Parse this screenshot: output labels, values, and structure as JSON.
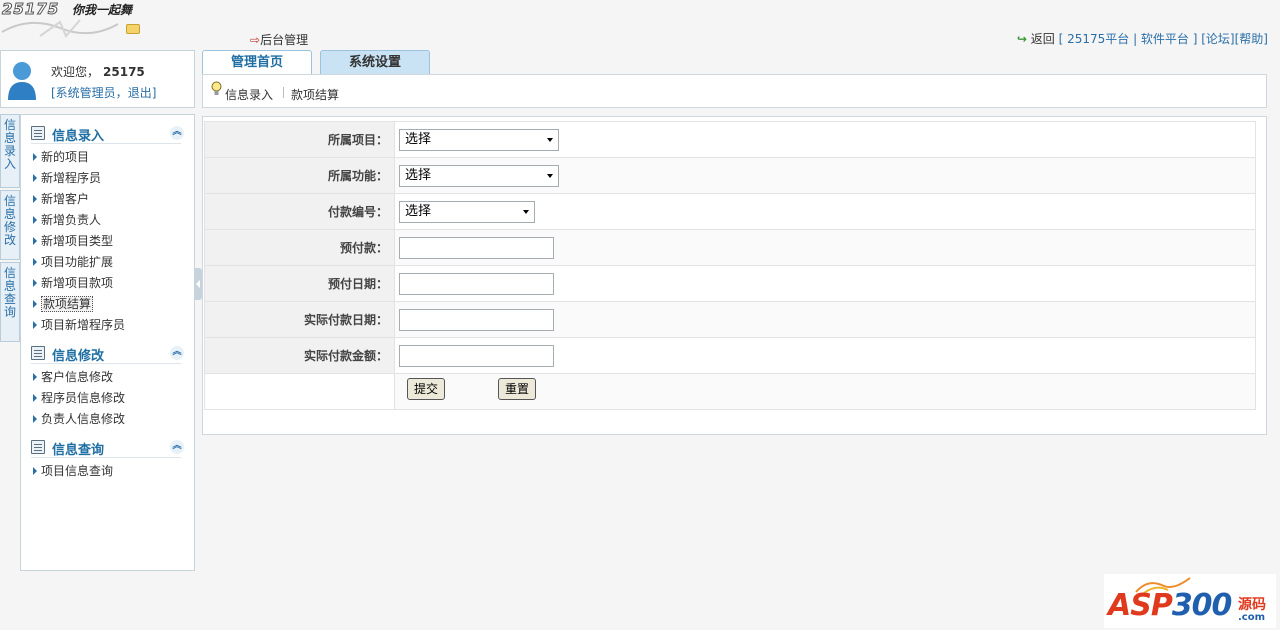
{
  "logo": {
    "number": "25175",
    "slogan": "你我一起舞"
  },
  "header": {
    "admin_link": "后台管理",
    "return_label": "返回",
    "platform_link": "[ 25175平台",
    "separator": " | ",
    "software_link": "软件平台 ]",
    "forum_link": "[论坛]",
    "help_link": "[帮助]"
  },
  "user": {
    "welcome": "欢迎您，",
    "name": "25175",
    "role": "[系统管理员，",
    "logout": "退出]"
  },
  "tabs": [
    {
      "label": "管理首页",
      "active": true
    },
    {
      "label": "系统设置",
      "active": false
    }
  ],
  "subnav": {
    "item1": "信息录入",
    "item2": "款项结算"
  },
  "vtabs": [
    {
      "label": "信息录入"
    },
    {
      "label": "信息修改"
    },
    {
      "label": "信息查询"
    }
  ],
  "menu": {
    "sections": [
      {
        "title": "信息录入",
        "items": [
          "新的项目",
          "新增程序员",
          "新增客户",
          "新增负责人",
          "新增项目类型",
          "项目功能扩展",
          "新增项目款项",
          "款项结算",
          "项目新增程序员"
        ]
      },
      {
        "title": "信息修改",
        "items": [
          "客户信息修改",
          "程序员信息修改",
          "负责人信息修改"
        ]
      },
      {
        "title": "信息查询",
        "items": [
          "项目信息查询"
        ]
      }
    ],
    "collapse_glyph": "︽"
  },
  "form": {
    "project_label": "所属项目：",
    "project_value": "选择",
    "function_label": "所属功能：",
    "function_value": "选择",
    "payment_no_label": "付款编号：",
    "payment_no_value": "选择",
    "prepay_label": "预付款：",
    "prepay_value": "",
    "prepay_date_label": "预付日期：",
    "prepay_date_value": "",
    "actual_date_label": "实际付款日期：",
    "actual_date_value": "",
    "actual_amount_label": "实际付款金额：",
    "actual_amount_value": "",
    "submit": "提交",
    "reset": "重置"
  },
  "watermark": {
    "main": "ASP",
    "num": "300",
    "side": "源码",
    "com": ".com"
  },
  "colors": {
    "accent": "#1f6fa3",
    "tab_inactive": "#c9e3f5",
    "label_bg": "#f1f1f1"
  }
}
